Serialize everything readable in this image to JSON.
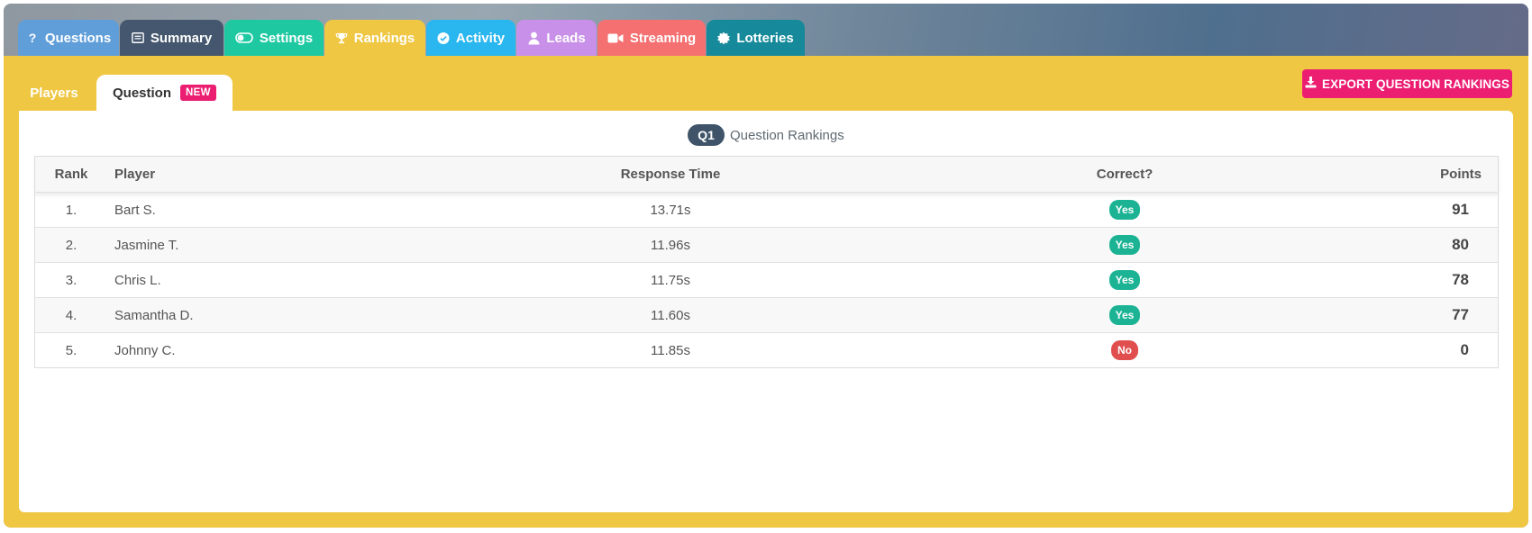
{
  "tabs": [
    {
      "label": "Questions",
      "icon": "question-icon",
      "color": "#5f9ed9"
    },
    {
      "label": "Summary",
      "icon": "list-icon",
      "color": "#44576e"
    },
    {
      "label": "Settings",
      "icon": "toggle-icon",
      "color": "#1ec9a2"
    },
    {
      "label": "Rankings",
      "icon": "trophy-icon",
      "color": "#efc743"
    },
    {
      "label": "Activity",
      "icon": "check-circle-icon",
      "color": "#2ab6ee"
    },
    {
      "label": "Leads",
      "icon": "user-icon",
      "color": "#c890e8"
    },
    {
      "label": "Streaming",
      "icon": "video-icon",
      "color": "#f47071"
    },
    {
      "label": "Lotteries",
      "icon": "badge-icon",
      "color": "#16899a"
    }
  ],
  "subtabs": {
    "players": "Players",
    "question": "Question",
    "new_badge": "NEW"
  },
  "export_button": "EXPORT QUESTION RANKINGS",
  "panel": {
    "question_badge": "Q1",
    "title": "Question Rankings"
  },
  "table": {
    "headers": {
      "rank": "Rank",
      "player": "Player",
      "time": "Response Time",
      "correct": "Correct?",
      "points": "Points"
    },
    "rows": [
      {
        "rank": "1.",
        "player": "Bart S.",
        "time": "13.71s",
        "correct": "Yes",
        "points": "91"
      },
      {
        "rank": "2.",
        "player": "Jasmine T.",
        "time": "11.96s",
        "correct": "Yes",
        "points": "80"
      },
      {
        "rank": "3.",
        "player": "Chris L.",
        "time": "11.75s",
        "correct": "Yes",
        "points": "78"
      },
      {
        "rank": "4.",
        "player": "Samantha D.",
        "time": "11.60s",
        "correct": "Yes",
        "points": "77"
      },
      {
        "rank": "5.",
        "player": "Johnny C.",
        "time": "11.85s",
        "correct": "No",
        "points": "0"
      }
    ]
  },
  "colors": {
    "accent_yellow": "#efc743",
    "pink": "#ec1e72",
    "yes_green": "#1bb394",
    "no_red": "#e04e4e"
  }
}
